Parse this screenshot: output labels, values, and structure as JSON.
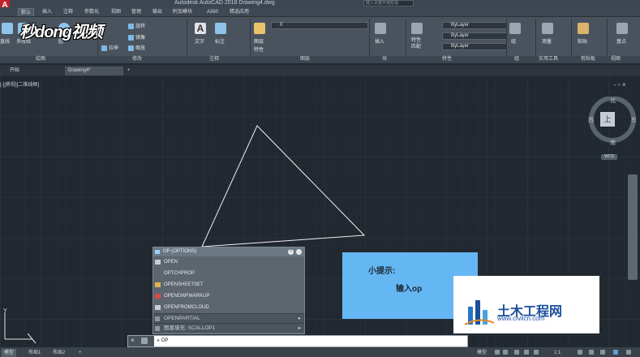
{
  "app": {
    "title": "Autodesk AutoCAD 2018    Drawing4.dwg",
    "search_placeholder": "键入关键字或短语",
    "logo_letter": "A"
  },
  "ribbon_tabs": [
    "默认",
    "插入",
    "注释",
    "参数化",
    "视图",
    "管理",
    "输出",
    "附加模块",
    "A360",
    "精选应用"
  ],
  "ribbon": {
    "draw_buttons": [
      "直线",
      "多段线",
      "圆",
      "圆弧"
    ],
    "modify_buttons": [
      "旋转",
      "镜像",
      "拉伸",
      "缩放"
    ],
    "annotation_buttons": [
      "文字",
      "标注"
    ],
    "layer_buttons": [
      "图层",
      "特性"
    ],
    "layer_value": "0",
    "block_button": "插入",
    "properties_button": "特性\n匹配",
    "bylayer": [
      "ByLayer",
      "ByLayer",
      "ByLayer"
    ],
    "group_button": "组",
    "utilities_button": "测量",
    "clipboard_button": "粘贴",
    "base_button": "基点",
    "panel_labels": [
      "绘图",
      "修改",
      "注释",
      "图层",
      "块",
      "特性",
      "组",
      "实用工具",
      "剪贴板",
      "视图"
    ]
  },
  "watermark": "秒dong视频",
  "doc_tabs": [
    "开始",
    "Drawing4*"
  ],
  "view_label": "[-][俯视][二维线框]",
  "viewcube": {
    "north": "北",
    "south": "南",
    "east": "东",
    "west": "西",
    "center": "上",
    "wcs": "WCS"
  },
  "autocomplete": {
    "header": "OP (OPTIONS)",
    "items": [
      "OPEN",
      "OPTCHPROP",
      "OPENSHEETSET",
      "OPENDWFMARKUP",
      "OPENFROMCLOUD"
    ],
    "footer": [
      "OPENPARTIAL",
      "图案填充: SCALLOP1"
    ]
  },
  "tip": {
    "title": "小提示:",
    "body": "输入op"
  },
  "site_logo": {
    "name": "土木工程网",
    "url": "www.civilcn.com"
  },
  "command": {
    "value": "OP"
  },
  "status_tabs": [
    "模型",
    "布局1",
    "布局2"
  ],
  "status_right": [
    "模型",
    "1:1"
  ],
  "ucs_y": "Y"
}
